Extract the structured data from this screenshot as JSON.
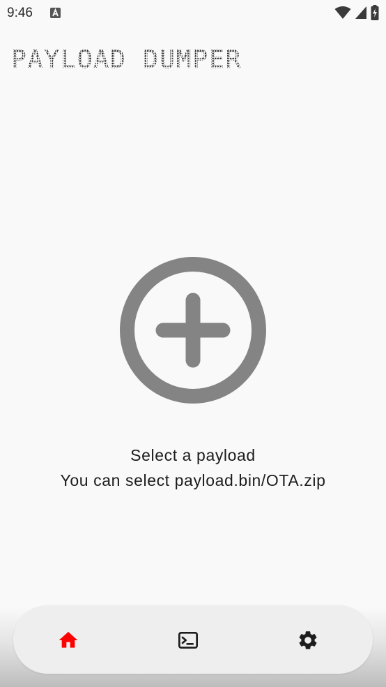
{
  "status_bar": {
    "time": "9:46",
    "icons": [
      "notification-a-icon",
      "wifi-icon",
      "cellular-signal-icon",
      "battery-charging-icon"
    ]
  },
  "app": {
    "title": "PAYLOAD DUMPER"
  },
  "main": {
    "add_icon": "add-circle-icon",
    "message_line1": "Select a payload",
    "message_line2": "You can select payload.bin/OTA.zip"
  },
  "bottom_nav": {
    "items": [
      {
        "id": "home",
        "icon": "home-icon",
        "selected": true
      },
      {
        "id": "terminal",
        "icon": "terminal-icon",
        "selected": false
      },
      {
        "id": "settings",
        "icon": "gear-icon",
        "selected": false
      }
    ]
  },
  "colors": {
    "background": "#f9f9f9",
    "accent": "#ff0000",
    "icon_gray": "#848484",
    "text": "#1c1c1c",
    "nav_background": "#eeeeee"
  }
}
